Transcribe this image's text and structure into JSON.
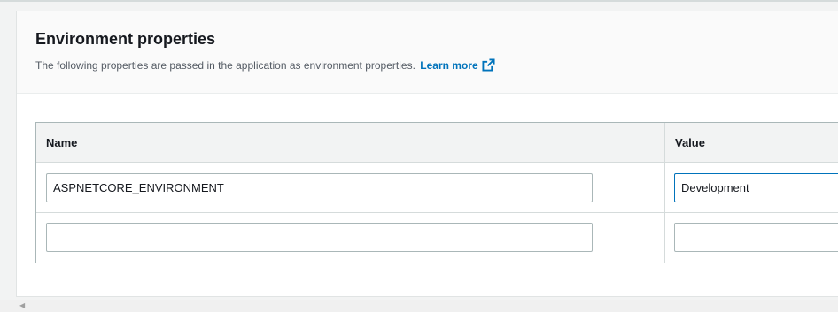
{
  "section": {
    "title": "Environment properties",
    "description": "The following properties are passed in the application as environment properties.",
    "learn_more": "Learn more"
  },
  "table": {
    "columns": [
      "Name",
      "Value"
    ],
    "rows": [
      {
        "name": "ASPNETCORE_ENVIRONMENT",
        "value": "Development"
      },
      {
        "name": "",
        "value": ""
      }
    ]
  },
  "icons": {
    "learn_more": "external-link-icon",
    "scroll_left": "scroll-left-arrow-icon"
  },
  "colors": {
    "link": "#0073bb",
    "focus_border": "#0073bb"
  }
}
